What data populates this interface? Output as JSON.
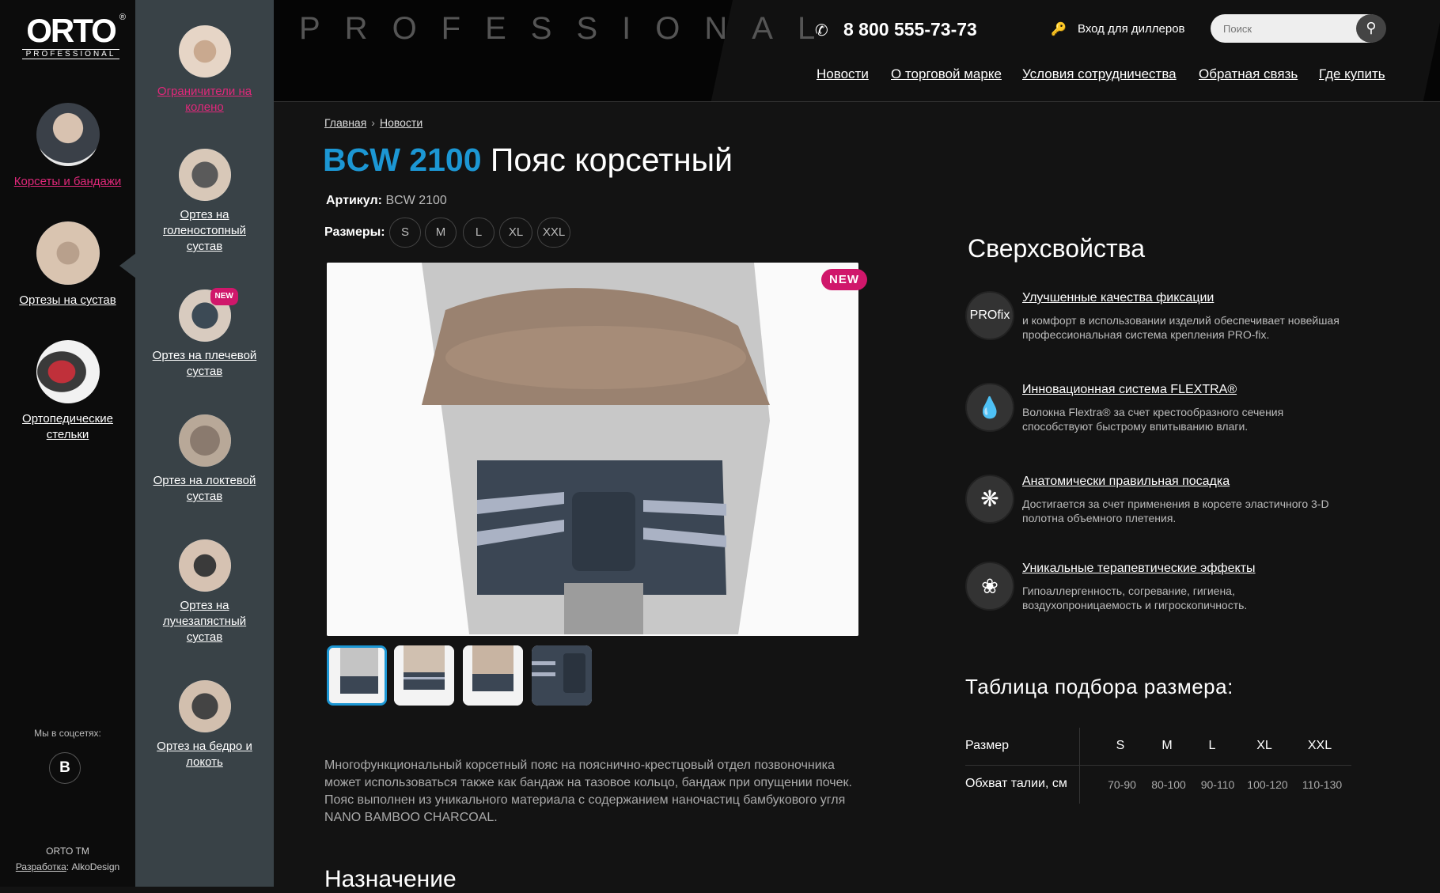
{
  "brand": {
    "logo_main": "ORTO",
    "logo_sub": "PROFESSIONAL",
    "logo_reg": "®"
  },
  "left_nav": {
    "items": [
      {
        "label": "Корсеты и бандажи",
        "active": true
      },
      {
        "label": "Ортезы на сустав",
        "active": false
      },
      {
        "label": "Ортопедические стельки",
        "active": false
      }
    ],
    "social_label": "Мы в соцсетях:",
    "social_vk": "В",
    "footer_tm": "ORTO TM",
    "footer_dev_label": "Разработка",
    "footer_dev_name": ": AlkoDesign"
  },
  "sub_nav": {
    "items": [
      {
        "label": "Ограничители на колено",
        "active": true
      },
      {
        "label": "Ортез на голеностопный сустав"
      },
      {
        "label": "Ортез на плечевой сустав",
        "badge": "NEW"
      },
      {
        "label": "Ортез на локтевой сустав"
      },
      {
        "label": "Ортез на лучезапястный сустав"
      },
      {
        "label": "Ортез на бедро и локоть"
      }
    ]
  },
  "header": {
    "tagline": "PROFESSIONAL",
    "phone": "8 800 555-73-73",
    "dealer_login": "Вход для диллеров",
    "search_placeholder": "Поиск",
    "nav": [
      "Новости",
      "О торговой марке",
      "Условия сотрудничества",
      "Обратная связь",
      "Где купить"
    ]
  },
  "breadcrumbs": [
    "Главная",
    "Новости"
  ],
  "product": {
    "code": "BCW 2100",
    "name": "Пояс корсетный",
    "article_label": "Артикул:",
    "article_value": "BCW 2100",
    "sizes_label": "Размеры:",
    "sizes": [
      "S",
      "M",
      "L",
      "XL",
      "XXL"
    ],
    "badge": "NEW",
    "description": "Многофункциональный корсетный пояс на пояснично-крестцовый отдел позвоночника может использоваться также как бандаж на тазовое кольцо, бандаж при опущении почек. Пояс выполнен из уникального материала с содержанием наночастиц бамбукового угля NANO BAMBOO CHARCOAL.",
    "purpose_heading": "Назначение"
  },
  "features": {
    "heading": "Сверхсвойства",
    "items": [
      {
        "icon": "profix-icon",
        "icon_text": "PROfix",
        "title": "Улучшенные качества фиксации",
        "text": "и комфорт в использовании изделий обеспечивает новейшая профессиональная система крепления PRO-fix."
      },
      {
        "icon": "drops-icon",
        "title": "Инновационная система FLEXTRA®",
        "text": "Волокна Flextra® за счет крестообразного сечения способствуют быстрому впитыванию влаги."
      },
      {
        "icon": "weave-icon",
        "title": "Анатомически правильная посадка",
        "text": "Достигается за счет применения в корсете эластичного 3-D полотна объемного плетения."
      },
      {
        "icon": "bamboo-icon",
        "title": "Уникальные терапевтические эффекты",
        "text": "Гипоаллергенность, согревание, гигиена, воздухопроницаемость и гигроскопичность."
      }
    ]
  },
  "size_table": {
    "heading": "Таблица подбора размера:",
    "row_header": "Размер",
    "row_label": "Обхват талии, см",
    "sizes": [
      "S",
      "M",
      "L",
      "XL",
      "XXL"
    ],
    "values": [
      "70-90",
      "80-100",
      "90-110",
      "100-120",
      "110-130"
    ]
  },
  "colors": {
    "accent_blue": "#1c97d4",
    "accent_pink": "#e0287a",
    "badge": "#d0176b"
  }
}
